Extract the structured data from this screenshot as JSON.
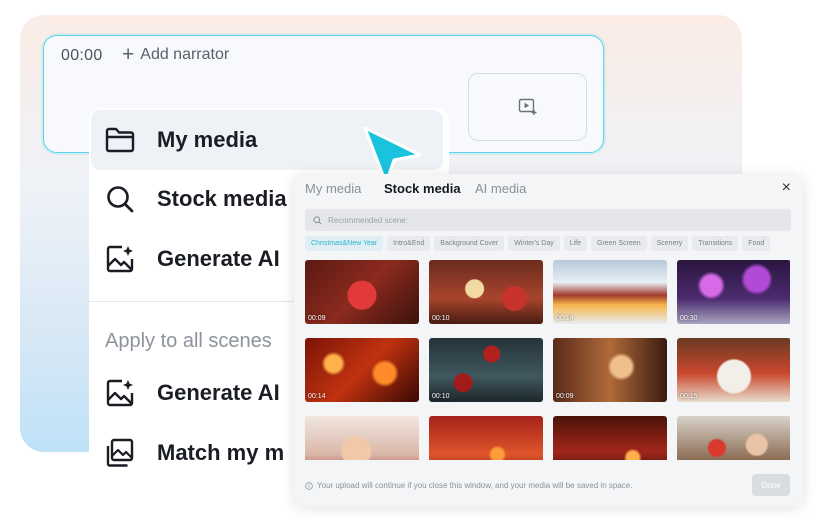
{
  "narrator": {
    "time": "00:00",
    "add_label": "Add narrator"
  },
  "menu": {
    "items": [
      {
        "label": "My media",
        "icon": "folder-icon"
      },
      {
        "label": "Stock media",
        "icon": "search-icon"
      },
      {
        "label": "Generate AI",
        "icon": "ai-image-icon"
      }
    ],
    "section_title": "Apply to all scenes",
    "section_items": [
      {
        "label": "Generate AI",
        "icon": "ai-image-icon"
      },
      {
        "label": "Match my m",
        "icon": "gallery-icon"
      }
    ]
  },
  "panel": {
    "tabs": [
      "My media",
      "Stock media",
      "AI media"
    ],
    "active_tab": "Stock media",
    "close_label": "×",
    "search_placeholder": "Recommended scene:",
    "categories": [
      "Christmas&New Year",
      "Intro&End",
      "Background Cover",
      "Winter's Day",
      "Life",
      "Green Screen",
      "Scenery",
      "Transitions",
      "Food"
    ],
    "active_category": "Christmas&New Year",
    "thumbnails": [
      {
        "duration": "00:09"
      },
      {
        "duration": "00:10"
      },
      {
        "duration": "00:14"
      },
      {
        "duration": "00:30"
      },
      {
        "duration": "00:14"
      },
      {
        "duration": "00:10"
      },
      {
        "duration": "00:09"
      },
      {
        "duration": "00:15"
      },
      {
        "duration": ""
      },
      {
        "duration": ""
      },
      {
        "duration": ""
      },
      {
        "duration": ""
      }
    ],
    "footer_note": "Your upload will continue if you close this window, and your media will be saved in space.",
    "done_label": "Done"
  },
  "colors": {
    "accent": "#26c4dd",
    "cursor": "#19c2dd"
  }
}
